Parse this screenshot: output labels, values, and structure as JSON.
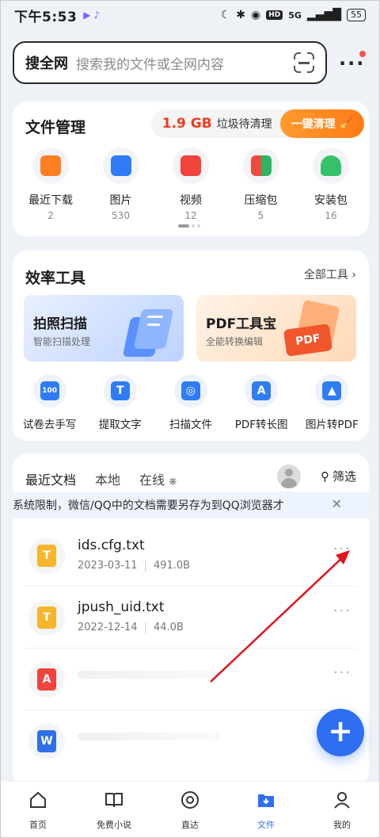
{
  "status_bar": {
    "time": "下午5:53",
    "signal": "5G",
    "battery": "55"
  },
  "search": {
    "brand": "搜全网",
    "placeholder": "搜索我的文件或全网内容"
  },
  "file_management": {
    "title": "文件管理",
    "junk_size": "1.9 GB",
    "junk_text": "垃圾待清理",
    "clean_button": "一键清理",
    "categories": [
      {
        "label": "最近下载",
        "count": "2",
        "icon": "download-icon",
        "color": "#ff7d23"
      },
      {
        "label": "图片",
        "count": "530",
        "icon": "image-icon",
        "color": "#2f7cf6"
      },
      {
        "label": "视频",
        "count": "12",
        "icon": "video-icon",
        "color": "#f0443c"
      },
      {
        "label": "压缩包",
        "count": "5",
        "icon": "archive-icon",
        "color": "#f2a21b"
      },
      {
        "label": "安装包",
        "count": "16",
        "icon": "android-icon",
        "color": "#36c26b"
      }
    ]
  },
  "tools": {
    "title": "效率工具",
    "all_tools": "全部工具",
    "banners": [
      {
        "title": "拍照扫描",
        "subtitle": "智能扫描处理"
      },
      {
        "title": "PDF工具宝",
        "subtitle": "全能转换编辑"
      }
    ],
    "items": [
      {
        "label": "试卷去手写",
        "glyph": "100"
      },
      {
        "label": "提取文字",
        "glyph": "T"
      },
      {
        "label": "扫描文件",
        "glyph": "◎"
      },
      {
        "label": "PDF转长图",
        "glyph": "A"
      },
      {
        "label": "图片转PDF",
        "glyph": "▲"
      }
    ]
  },
  "docs": {
    "tabs": [
      "最近文档",
      "本地",
      "在线"
    ],
    "filter": "筛选",
    "notice": "系统限制，微信/QQ中的文档需要另存为到QQ浏览器才",
    "items": [
      {
        "name": "ids.cfg.txt",
        "date": "2023-03-11",
        "size": "491.0B",
        "type": "txt"
      },
      {
        "name": "jpush_uid.txt",
        "date": "2022-12-14",
        "size": "44.0B",
        "type": "txt"
      },
      {
        "name": "",
        "date": "",
        "size": "",
        "type": "pdf"
      },
      {
        "name": "",
        "date": "",
        "size": "",
        "type": "word"
      }
    ]
  },
  "fab": {
    "label": "+"
  },
  "bottom_nav": [
    {
      "label": "首页",
      "icon": "home-icon"
    },
    {
      "label": "免费小说",
      "icon": "book-icon"
    },
    {
      "label": "直达",
      "icon": "at-icon"
    },
    {
      "label": "文件",
      "icon": "file-icon",
      "active": true
    },
    {
      "label": "我的",
      "icon": "profile-icon"
    }
  ],
  "colors": {
    "accent": "#2e6ff2",
    "junk": "#ee3b22",
    "clean": "#ff7a14",
    "annotation_arrow": "#e0131b"
  }
}
